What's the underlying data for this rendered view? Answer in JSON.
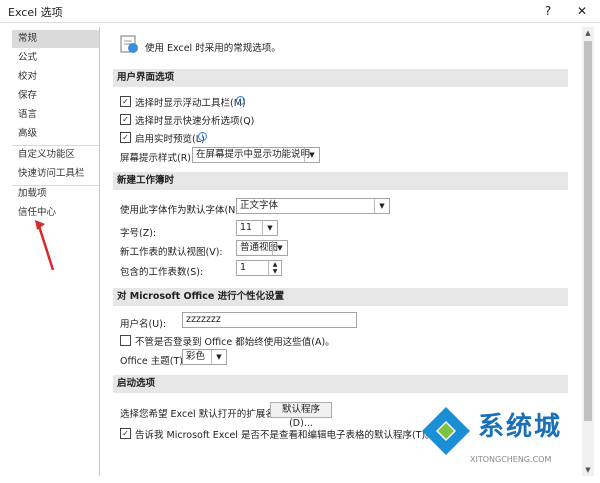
{
  "window": {
    "title": "Excel 选项",
    "help_glyph": "?",
    "close_glyph": "✕"
  },
  "sidebar": {
    "items": [
      {
        "label": "常规",
        "active": true
      },
      {
        "label": "公式"
      },
      {
        "label": "校对"
      },
      {
        "label": "保存"
      },
      {
        "label": "语言"
      },
      {
        "label": "高级"
      },
      {
        "label": "自定义功能区"
      },
      {
        "label": "快速访问工具栏"
      },
      {
        "label": "加载项"
      },
      {
        "label": "信任中心"
      }
    ]
  },
  "main": {
    "intro": "使用 Excel 时采用的常规选项。",
    "ui_section": {
      "header": "用户界面选项",
      "opt1": "选择时显示浮动工具栏(M)",
      "opt2": "选择时显示快速分析选项(Q)",
      "opt3": "启用实时预览(L)",
      "tooltip_label": "屏幕提示样式(R):",
      "tooltip_value": "在屏幕提示中显示功能说明"
    },
    "workbook_section": {
      "header": "新建工作簿时",
      "font_label": "使用此字体作为默认字体(N):",
      "font_value": "正文字体",
      "size_label": "字号(Z):",
      "size_value": "11",
      "view_label": "新工作表的默认视图(V):",
      "view_value": "普通视图",
      "sheets_label": "包含的工作表数(S):",
      "sheets_value": "1"
    },
    "personal_section": {
      "header": "对 Microsoft Office 进行个性化设置",
      "user_label": "用户名(U):",
      "user_value": "zzzzzzz",
      "always_label": "不管是否登录到 Office 都始终使用这些值(A)。",
      "theme_label": "Office 主题(T):",
      "theme_value": "彩色"
    },
    "startup_section": {
      "header": "启动选项",
      "ext_label": "选择您希望 Excel 默认打开的扩展名:",
      "default_programs": "默认程序(D)...",
      "tell_label": "告诉我 Microsoft Excel 是否不是查看和编辑电子表格的默认程序(T)。"
    }
  },
  "watermark": {
    "brand": "系统城",
    "url": "XITONGCHENG.COM"
  }
}
